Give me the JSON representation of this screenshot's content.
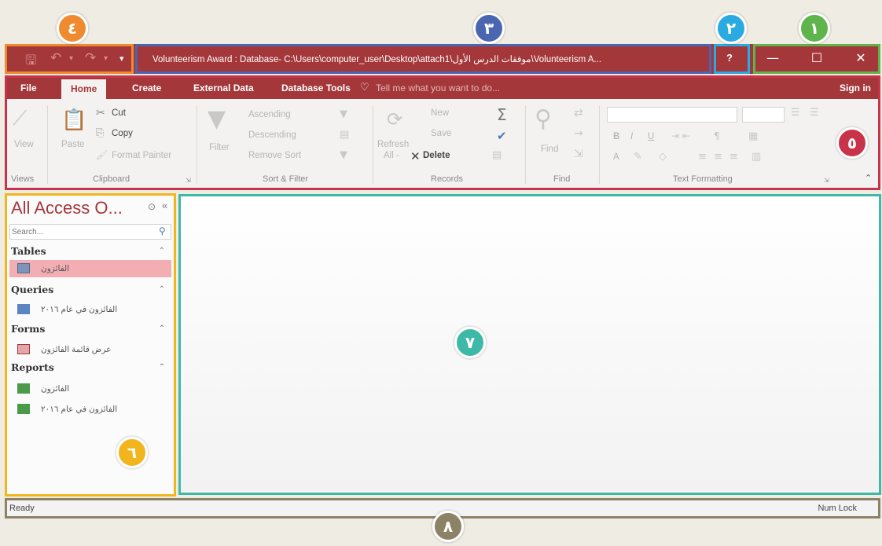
{
  "title_bar": {
    "title": "Volunteerism Award : Database- C:\\Users\\computer_user\\Desktop\\attach1\\موفقات الدرس الأول\\Volunteerism A...",
    "help": "?",
    "minimize": "—",
    "maximize": "☐",
    "close": "✕"
  },
  "tabs": [
    "File",
    "Home",
    "Create",
    "External Data",
    "Database Tools"
  ],
  "tell_me": "Tell me what you want to do...",
  "sign_in": "Sign in",
  "ribbon": {
    "views": {
      "view": "View",
      "label": "Views"
    },
    "clipboard": {
      "paste": "Paste",
      "cut": "Cut",
      "copy": "Copy",
      "format_painter": "Format Painter",
      "label": "Clipboard"
    },
    "sort_filter": {
      "filter": "Filter",
      "ascending": "Ascending",
      "descending": "Descending",
      "remove_sort": "Remove Sort",
      "label": "Sort & Filter"
    },
    "records": {
      "refresh": "Refresh",
      "refresh_all": "All -",
      "new": "New",
      "save": "Save",
      "delete": "Delete",
      "label": "Records"
    },
    "find": {
      "find": "Find",
      "label": "Find"
    },
    "text_formatting": {
      "label": "Text Formatting",
      "bold": "B",
      "italic": "I",
      "underline": "U",
      "font_color": "A"
    }
  },
  "nav": {
    "title": "All Access O...",
    "search_placeholder": "Search...",
    "sections": [
      {
        "name": "Tables",
        "items": [
          "الفائزون"
        ]
      },
      {
        "name": "Queries",
        "items": [
          "الفائزون في عام ٢٠١٦"
        ]
      },
      {
        "name": "Forms",
        "items": [
          "عرض قائمة الفائزون"
        ]
      },
      {
        "name": "Reports",
        "items": [
          "الفائزون",
          "الفائزون في عام ٢٠١٦"
        ]
      }
    ]
  },
  "status": {
    "ready": "Ready",
    "num_lock": "Num Lock"
  },
  "annotations": {
    "n1": "١",
    "n2": "٢",
    "n3": "٣",
    "n4": "٤",
    "n5": "٥",
    "n6": "٦",
    "n7": "٧",
    "n8": "٨"
  },
  "colors": {
    "access_red": "#a4373a",
    "green": "#5fb54b",
    "blue_light": "#29aae1",
    "blue": "#4b66b1",
    "orange": "#ef8a2f",
    "crimson": "#c8334a",
    "yellow": "#f2b51e",
    "teal": "#3fb9a7",
    "olive": "#8c8266"
  }
}
